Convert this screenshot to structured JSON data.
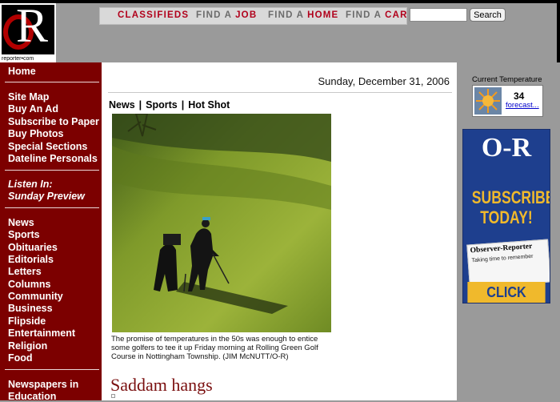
{
  "header": {
    "logo_url_text": "observer-reporter•com",
    "nav": [
      {
        "prefix": "CLASSIFIEDS",
        "highlight": ""
      },
      {
        "prefix": "FIND A ",
        "highlight": "JOB"
      },
      {
        "prefix": "FIND A ",
        "highlight": "HOME"
      },
      {
        "prefix": "FIND A ",
        "highlight": "CAR"
      }
    ],
    "search": {
      "value": "",
      "button": "Search"
    }
  },
  "sidebar": {
    "home": "Home",
    "group1": [
      "Site Map",
      "Buy An Ad",
      "Subscribe to Paper",
      "Buy Photos",
      "Special Sections",
      "Dateline Personals"
    ],
    "listen_title": "Listen In:",
    "listen_item": "Sunday Preview",
    "group2": [
      "News",
      "Sports",
      "Obituaries",
      "Editorials",
      "Letters",
      "Columns",
      "Community",
      "Business",
      "Flipside",
      "Entertainment",
      "Religion",
      "Food"
    ],
    "group3": [
      "Newspapers in",
      "Education"
    ]
  },
  "main": {
    "date": "Sunday, December 31, 2006",
    "tabs": [
      "News",
      "Sports",
      "Hot Shot"
    ],
    "caption": "The promise of temperatures in the 50s was enough to entice some golfers to tee it up Friday morning at Rolling Green Golf Course in Nottingham Township. (JIM McNUTT/O-R)",
    "headline": "Saddam hangs"
  },
  "right": {
    "temp_label": "Current Temperature",
    "temp_value": "34",
    "forecast_link": "forecast...",
    "ad": {
      "logo": "O-R",
      "line1": "SUBSCRIBE",
      "line2": "TODAY!",
      "paper_title": "Observer-Reporter",
      "paper_line": "Taking time to remember",
      "cta": "CLICK HERE"
    }
  },
  "colors": {
    "sidebar": "#7c0000",
    "nav_highlight": "#b1001b",
    "ad_blue": "#1e3f8e",
    "ad_gold": "#f0b92c"
  }
}
